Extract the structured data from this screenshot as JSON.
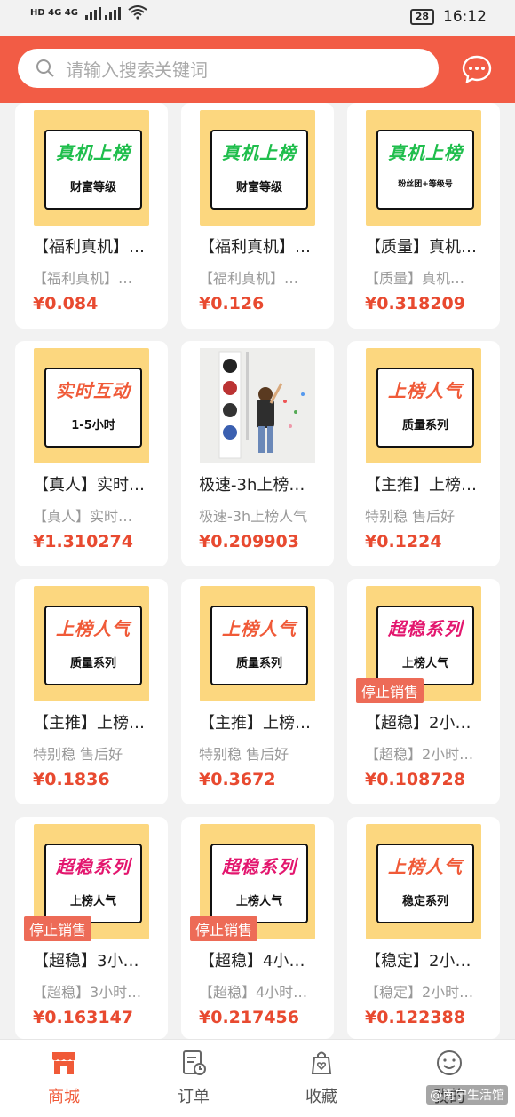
{
  "status_bar": {
    "left": "HD 4G 4G",
    "time": "16:12",
    "battery": "28"
  },
  "search": {
    "placeholder": "请输入搜索关键词",
    "icon": "search-icon",
    "chat_icon": "chat-icon"
  },
  "accent_color": "#f25c45",
  "products": [
    {
      "big": "真机上榜",
      "small": "财富等级",
      "big_color": "green",
      "title": "【福利真机】…",
      "desc": "【福利真机】…",
      "price": "¥0.084",
      "badge": ""
    },
    {
      "big": "真机上榜",
      "small": "财富等级",
      "big_color": "green",
      "title": "【福利真机】…",
      "desc": "【福利真机】…",
      "price": "¥0.126",
      "badge": ""
    },
    {
      "big": "真机上榜",
      "small": "粉丝团+等级号",
      "big_color": "green",
      "title": "【质量】真机…",
      "desc": "【质量】真机…",
      "price": "¥0.318209",
      "badge": ""
    },
    {
      "big": "实时互动",
      "small": "1-5小时",
      "big_color": "red",
      "title": "【真人】实时…",
      "desc": "【真人】实时…",
      "price": "¥1.310274",
      "badge": ""
    },
    {
      "big": "",
      "small": "",
      "big_color": "photo",
      "title": "极速-3h上榜…",
      "desc": "极速-3h上榜人气",
      "price": "¥0.209903",
      "badge": ""
    },
    {
      "big": "上榜人气",
      "small": "质量系列",
      "big_color": "red",
      "title": "【主推】上榜…",
      "desc": "特别稳 售后好",
      "price": "¥0.1224",
      "badge": ""
    },
    {
      "big": "上榜人气",
      "small": "质量系列",
      "big_color": "red",
      "title": "【主推】上榜…",
      "desc": "特别稳 售后好",
      "price": "¥0.1836",
      "badge": ""
    },
    {
      "big": "上榜人气",
      "small": "质量系列",
      "big_color": "red",
      "title": "【主推】上榜…",
      "desc": "特别稳 售后好",
      "price": "¥0.3672",
      "badge": ""
    },
    {
      "big": "超稳系列",
      "small": "上榜人气",
      "big_color": "pink",
      "title": "【超稳】2小…",
      "desc": "【超稳】2小时…",
      "price": "¥0.108728",
      "badge": "停止销售"
    },
    {
      "big": "超稳系列",
      "small": "上榜人气",
      "big_color": "pink",
      "title": "【超稳】3小…",
      "desc": "【超稳】3小时…",
      "price": "¥0.163147",
      "badge": "停止销售"
    },
    {
      "big": "超稳系列",
      "small": "上榜人气",
      "big_color": "pink",
      "title": "【超稳】4小…",
      "desc": "【超稳】4小时…",
      "price": "¥0.217456",
      "badge": "停止销售"
    },
    {
      "big": "上榜人气",
      "small": "稳定系列",
      "big_color": "red",
      "title": "【稳定】2小…",
      "desc": "【稳定】2小时…",
      "price": "¥0.122388",
      "badge": ""
    }
  ],
  "tabbar": [
    {
      "label": "商城",
      "icon": "shop-icon",
      "active": true
    },
    {
      "label": "订单",
      "icon": "order-icon",
      "active": false
    },
    {
      "label": "收藏",
      "icon": "favorite-bag-icon",
      "active": false
    },
    {
      "label": "我的",
      "icon": "smile-icon",
      "active": false
    }
  ],
  "watermark": "@南宁生活馆"
}
